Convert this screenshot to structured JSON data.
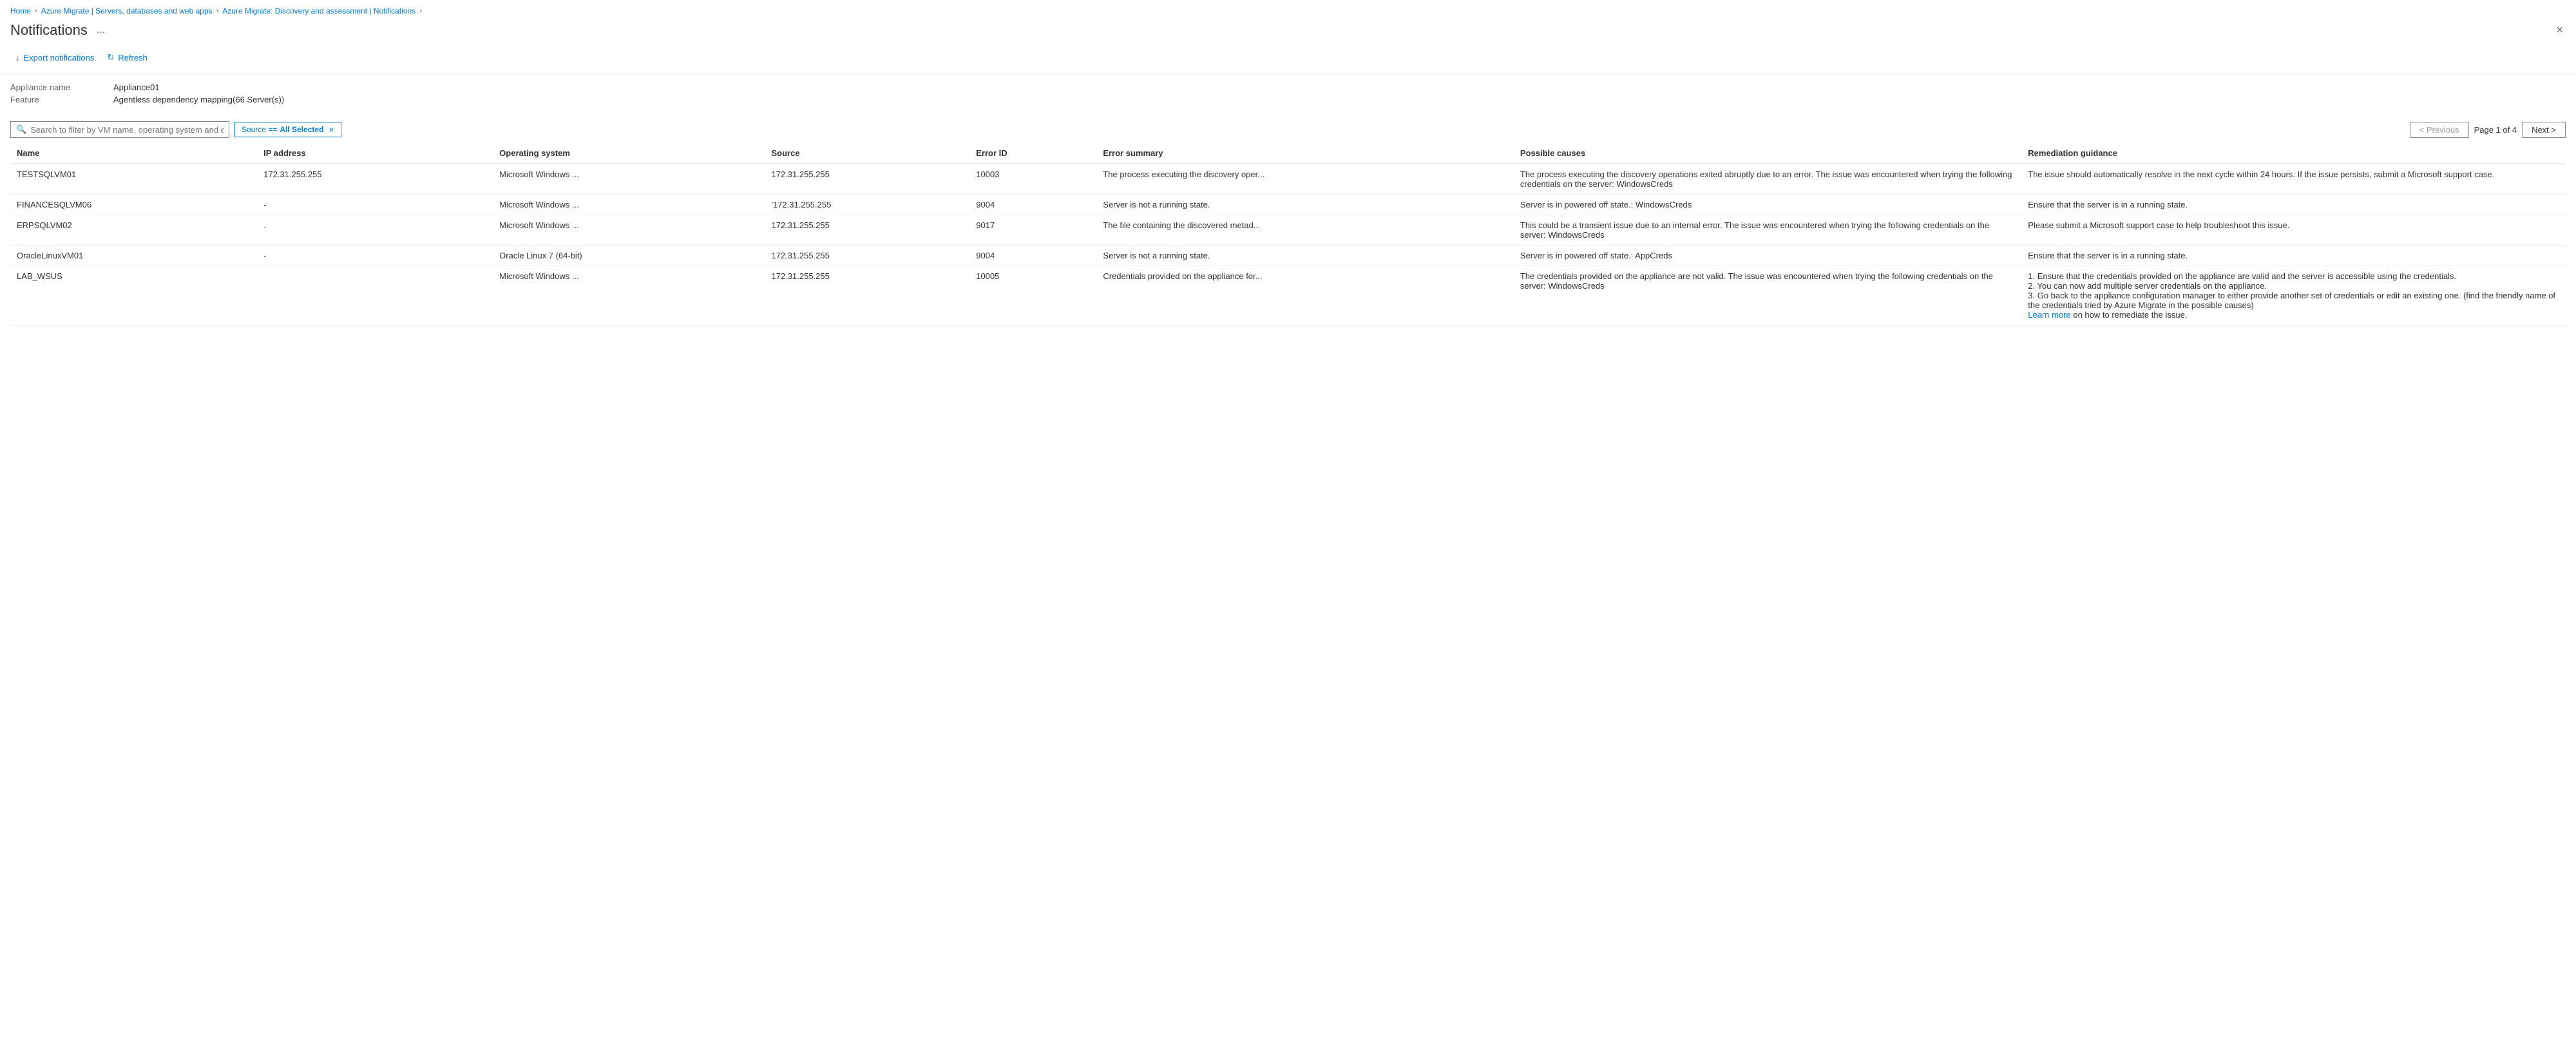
{
  "breadcrumb": {
    "items": [
      {
        "label": "Home",
        "link": true
      },
      {
        "label": "Azure Migrate | Servers, databases and web apps",
        "link": true
      },
      {
        "label": "Azure Migrate: Discovery and assessment | Notifications",
        "link": true
      }
    ],
    "separators": [
      ">",
      ">",
      ">"
    ]
  },
  "header": {
    "title": "Notifications",
    "ellipsis": "...",
    "close_label": "×"
  },
  "toolbar": {
    "export_label": "Export notifications",
    "refresh_label": "Refresh",
    "export_icon": "↓",
    "refresh_icon": "↻"
  },
  "meta": {
    "appliance_label": "Appliance name",
    "appliance_value": "Appliance01",
    "feature_label": "Feature",
    "feature_value": "Agentless dependency mapping(66 Server(s))"
  },
  "filter": {
    "search_placeholder": "Search to filter by VM name, operating system and error ID",
    "tag_label": "Source == ",
    "tag_value": "All Selected",
    "tag_close": "×"
  },
  "pagination": {
    "previous_label": "< Previous",
    "next_label": "Next >",
    "page_info": "Page 1 of 4"
  },
  "table": {
    "columns": [
      {
        "id": "name",
        "label": "Name"
      },
      {
        "id": "ip",
        "label": "IP address"
      },
      {
        "id": "os",
        "label": "Operating system"
      },
      {
        "id": "source",
        "label": "Source"
      },
      {
        "id": "errorid",
        "label": "Error ID"
      },
      {
        "id": "summary",
        "label": "Error summary"
      },
      {
        "id": "causes",
        "label": "Possible causes"
      },
      {
        "id": "remediation",
        "label": "Remediation guidance"
      }
    ],
    "rows": [
      {
        "name": "TESTSQLVM01",
        "ip": "172.31.255.255",
        "os": "Microsoft Windows ...",
        "source": "172.31.255.255",
        "errorid": "10003",
        "summary": "The process executing the discovery oper...",
        "causes": "The process executing the discovery operations exited abruptly due to an error. The issue was encountered when trying the following credentials on the server: WindowsCreds",
        "remediation": "The issue should automatically resolve in the next cycle within 24 hours. If the issue persists, submit a Microsoft support case.",
        "learn_more": false
      },
      {
        "name": "FINANCESQLVM06",
        "ip": "-",
        "os": "Microsoft Windows ...",
        "source": "'172.31.255.255",
        "errorid": "9004",
        "summary": "Server is not a running state.",
        "causes": "Server is in powered off state.: WindowsCreds",
        "remediation": "Ensure that the server is in a running state.",
        "learn_more": false
      },
      {
        "name": "ERPSQLVM02",
        "ip": ".",
        "os": "Microsoft Windows ...",
        "source": "172.31.255.255",
        "errorid": "9017",
        "summary": "The file containing the discovered metad...",
        "causes": "This could be a transient issue due to an internal error. The issue was encountered when trying the following credentials on the server: WindowsCreds",
        "remediation": "Please submit a Microsoft support case to help troubleshoot this issue.",
        "learn_more": false
      },
      {
        "name": "OracleLinuxVM01",
        "ip": "-",
        "os": "Oracle Linux 7 (64-bit)",
        "source": "172.31.255.255",
        "errorid": "9004",
        "summary": "Server is not a running state.",
        "causes": "Server is in powered off state.: AppCreds",
        "remediation": "Ensure that the server is in a running state.",
        "learn_more": false
      },
      {
        "name": "LAB_WSUS",
        "ip": "",
        "os": "Microsoft Windows ...",
        "source": "172.31.255.255",
        "errorid": "10005",
        "summary": "Credentials provided on the appliance for...",
        "causes": "The credentials provided on the appliance are not valid. The issue was encountered when trying the following credentials on the server: WindowsCreds",
        "remediation": "1. Ensure that the credentials provided on the appliance are valid and the server is accessible using the credentials.\n2. You can now add multiple server credentials on the appliance.\n3. Go back to the appliance configuration manager to either provide another set of credentials or edit an existing one. (find the friendly name of the credentials tried by Azure Migrate in the possible causes)",
        "learn_more": true,
        "learn_more_text": "Learn more"
      }
    ]
  }
}
